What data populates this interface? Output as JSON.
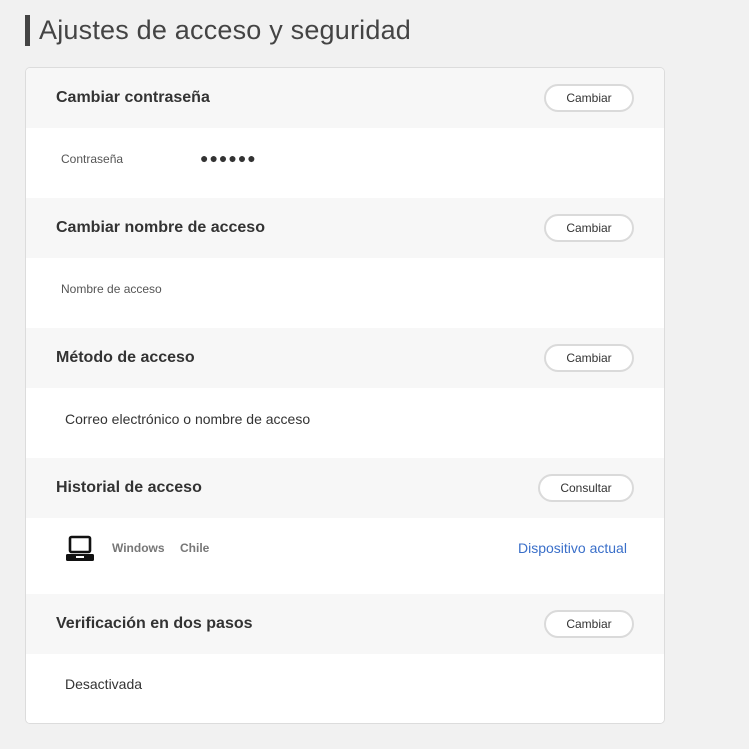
{
  "page": {
    "title": "Ajustes de acceso y seguridad"
  },
  "sections": {
    "password": {
      "title": "Cambiar contraseña",
      "button": "Cambiar",
      "label": "Contraseña",
      "value": "●●●●●●"
    },
    "login_name": {
      "title": "Cambiar nombre de acceso",
      "button": "Cambiar",
      "label": "Nombre de acceso",
      "value": ""
    },
    "login_method": {
      "title": "Método de acceso",
      "button": "Cambiar",
      "value": "Correo electrónico o nombre de acceso"
    },
    "login_history": {
      "title": "Historial de acceso",
      "button": "Consultar",
      "device_icon": "laptop-icon",
      "device_os": "Windows",
      "device_country": "Chile",
      "device_status": "Dispositivo actual"
    },
    "two_step": {
      "title": "Verificación en dos pasos",
      "button": "Cambiar",
      "value": "Desactivada"
    }
  },
  "colors": {
    "background": "#f1f1f1",
    "card": "#ffffff",
    "section_header": "#f7f7f7",
    "link": "#3a6fc9",
    "title_bar": "#444444"
  }
}
